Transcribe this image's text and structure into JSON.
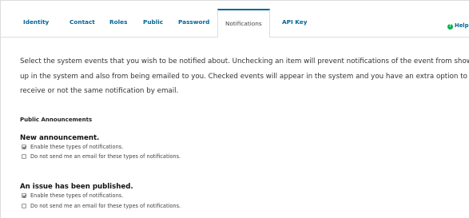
{
  "tabs": [
    {
      "label": "Identity"
    },
    {
      "label": "Contact"
    },
    {
      "label": "Roles"
    },
    {
      "label": "Public"
    },
    {
      "label": "Password"
    },
    {
      "label": "Notifications",
      "active": true
    },
    {
      "label": "API Key"
    }
  ],
  "help": {
    "label": "Help",
    "icon": "help-icon"
  },
  "intro": {
    "line1": "Select the system events that you wish to be notified about. Unchecking an item will prevent notifications of the event from showing",
    "line2": "up in the system and also from being emailed to you. Checked events will appear in the system and you have an extra option to",
    "line3": "receive or not the same notification by email."
  },
  "section": {
    "title": "Public Announcements"
  },
  "groups": [
    {
      "title": "New announcement.",
      "options": [
        {
          "label": "Enable these types of notifications.",
          "checked": true
        },
        {
          "label": "Do not send me an email for these types of notifications.",
          "checked": false
        }
      ]
    },
    {
      "title": "An issue has been published.",
      "options": [
        {
          "label": "Enable these types of notifications.",
          "checked": true
        },
        {
          "label": "Do not send me an email for these types of notifications.",
          "checked": false
        }
      ]
    }
  ],
  "colors": {
    "link": "#006798",
    "help_icon": "#00b24e"
  }
}
